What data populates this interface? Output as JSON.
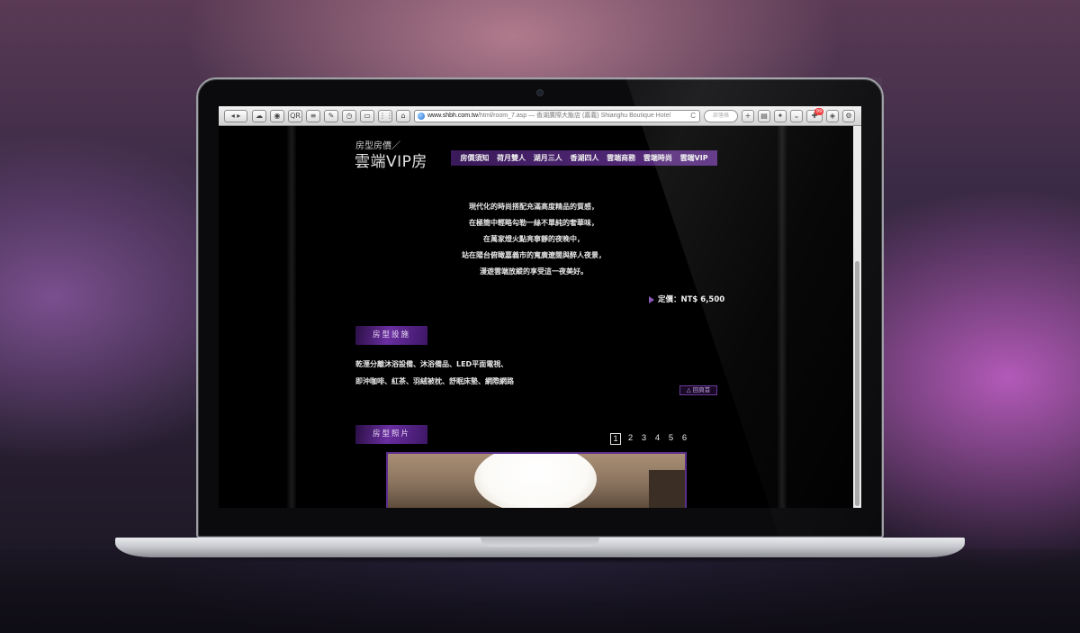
{
  "browser": {
    "url_domain": "www.shbh.com.tw",
    "url_path": "/html/room_7.asp",
    "page_title": "— 香湖廣際大飯店 (嘉義) Shianghu Boutique Hotel",
    "reload_symbol": "C",
    "search_placeholder": "部落格",
    "badge_count": "99"
  },
  "header": {
    "subtitle": "房型房價／",
    "title": "雲端VIP房"
  },
  "nav": {
    "items": [
      "房價須知",
      "荷月雙人",
      "湖月三人",
      "香湖四人",
      "雲端商務",
      "雲端時尚",
      "雲端VIP"
    ]
  },
  "intro": {
    "lines": [
      "現代化的時尚搭配充滿高度精品的質感，",
      "在極簡中輕略勾勒一絲不單純的奢華味，",
      "在萬家燈火點亮寧靜的夜晚中，",
      "站在陽台俯瞰嘉義市的寬廣遼闊與醉人夜景，",
      "漫遊雲端放縱的享受這一夜美好。"
    ]
  },
  "price": {
    "label": "定價：NT$ 6,500"
  },
  "facilities": {
    "heading": "房型設施",
    "line1": "乾溼分離沐浴設備、沐浴備品、LED平面電視、",
    "line2": "即沖咖啡、紅茶、羽絨被枕、舒眠床墊、網際網路",
    "back_label": "△ 回頁首"
  },
  "photos": {
    "heading": "房型照片",
    "pages": [
      "1",
      "2",
      "3",
      "4",
      "5",
      "6"
    ],
    "active_page": "1"
  },
  "colors": {
    "accent_purple": "#5b2e82",
    "page_bg": "#000000"
  }
}
